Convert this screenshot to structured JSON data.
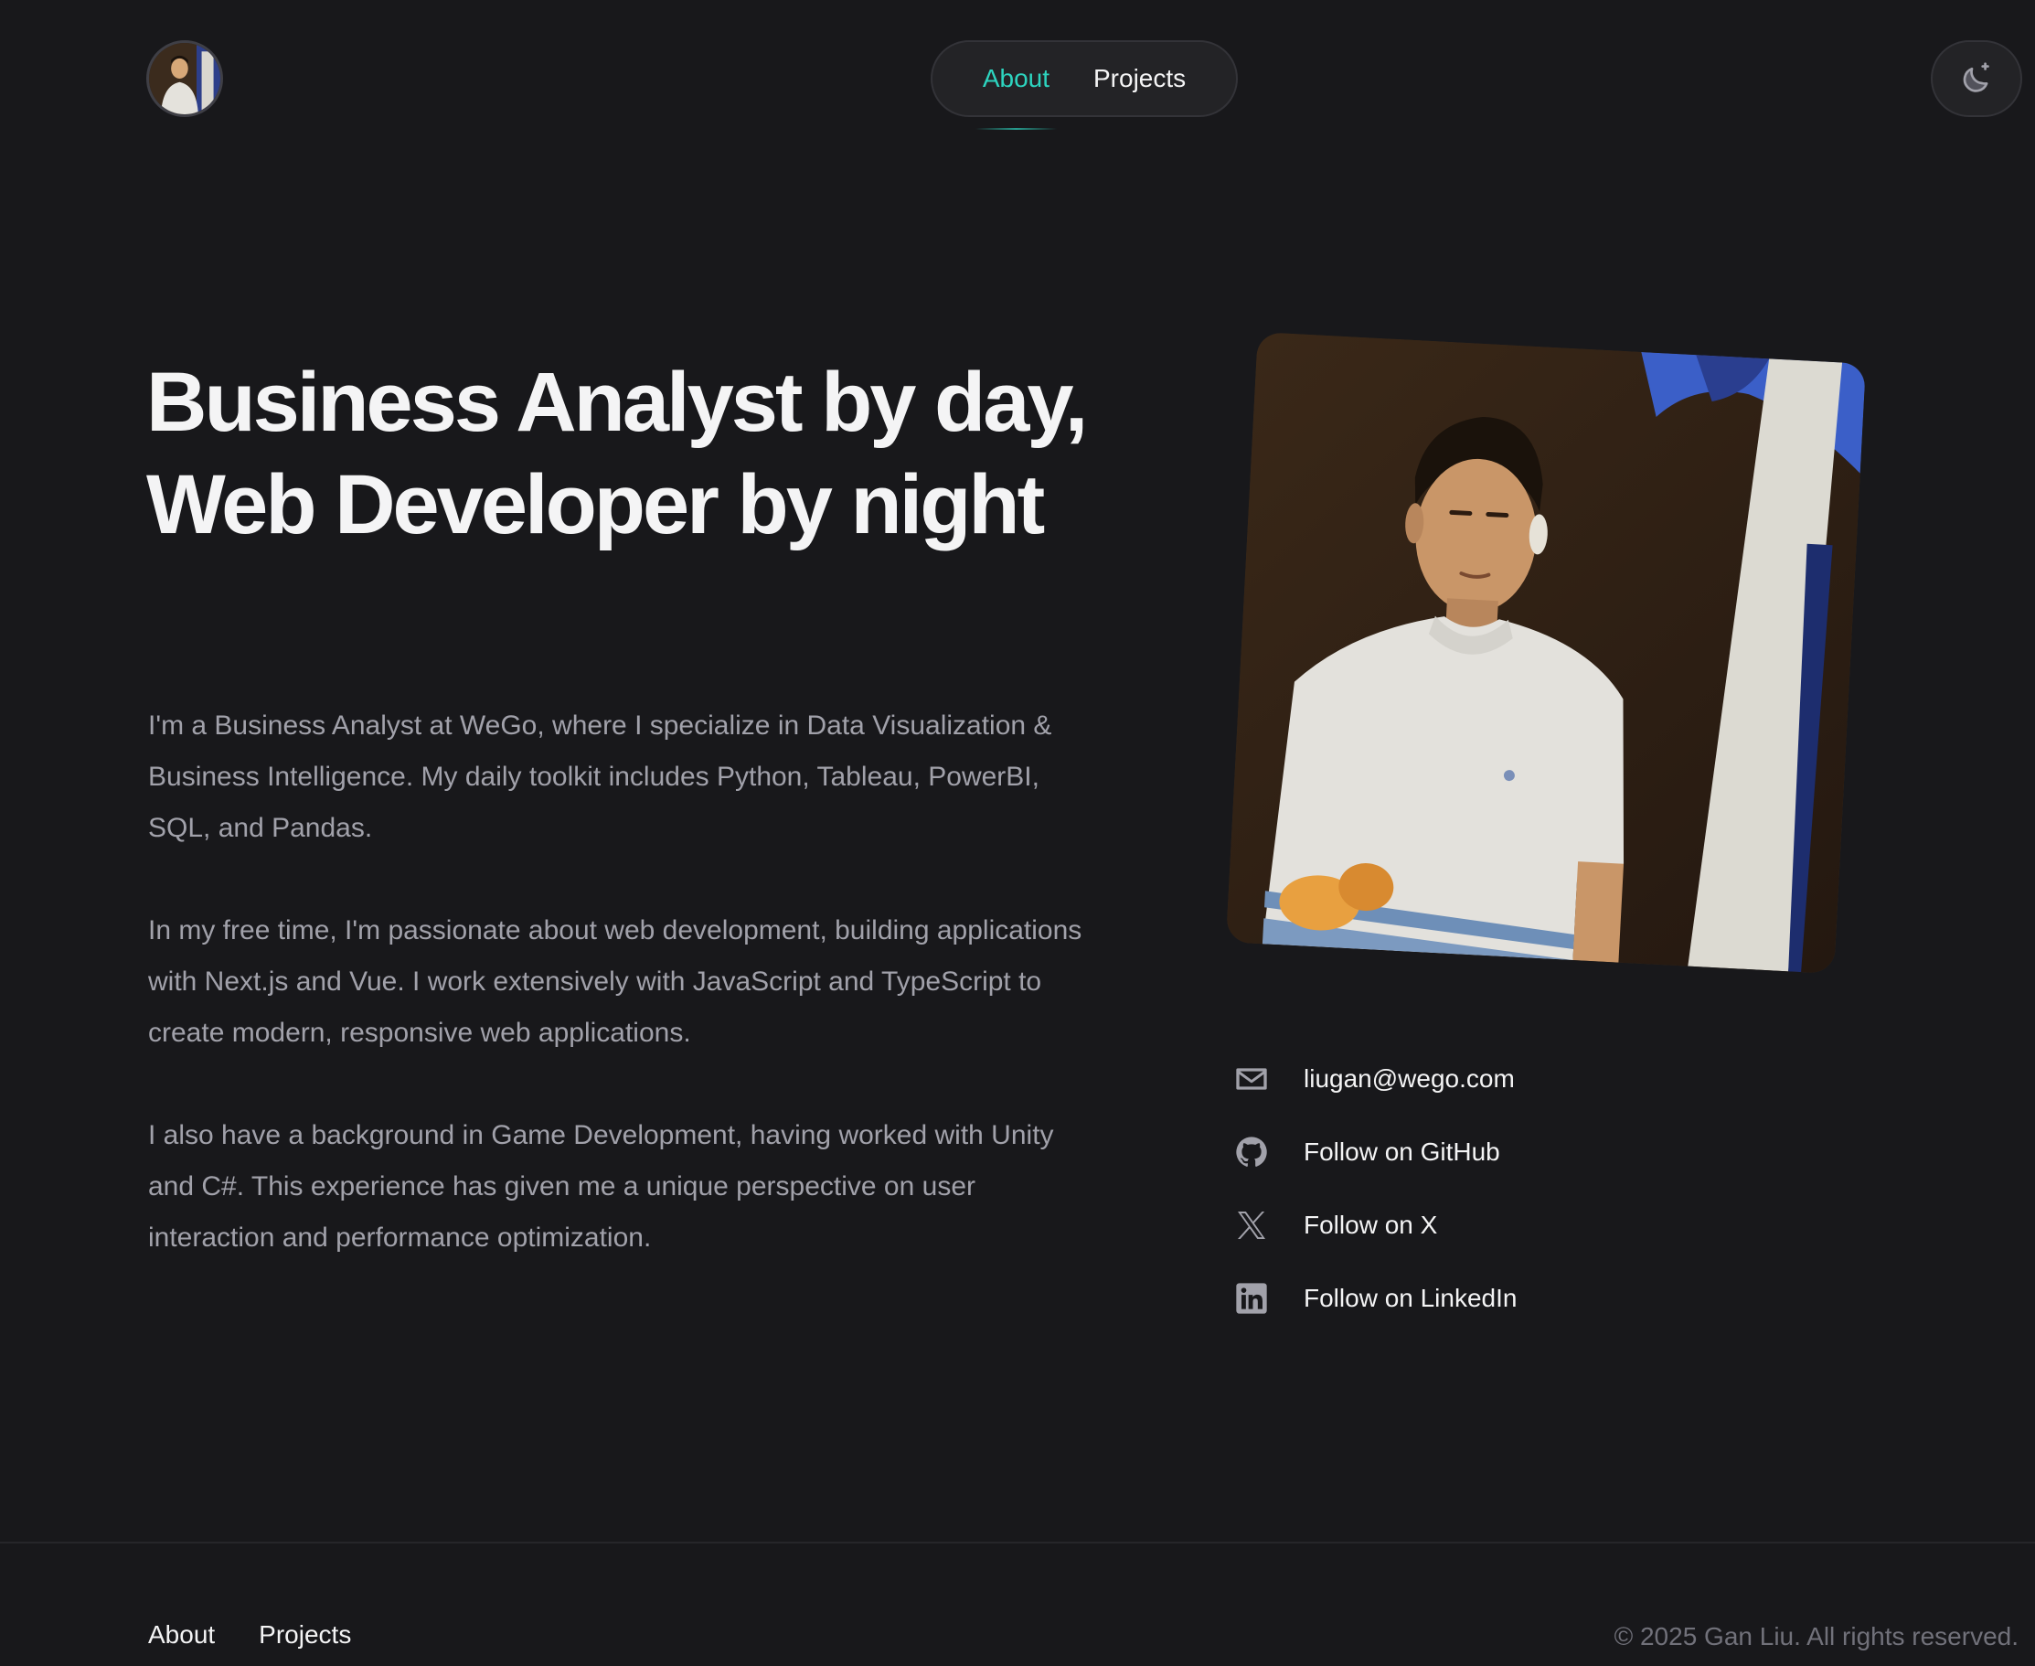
{
  "header": {
    "nav": [
      {
        "label": "About",
        "active": true
      },
      {
        "label": "Projects",
        "active": false
      }
    ],
    "theme_icon": "moon-sparkle-icon"
  },
  "hero": {
    "headline": "Business Analyst by day, Web Developer by night",
    "paragraphs": [
      "I'm a Business Analyst at WeGo, where I specialize in Data Visualization & Business Intelligence. My daily toolkit includes Python, Tableau, PowerBI, SQL, and Pandas.",
      "In my free time, I'm passionate about web development, building applications with Next.js and Vue. I work extensively with JavaScript and TypeScript to create modern, responsive web applications.",
      "I also have a background in Game Development, having worked with Unity and C#. This experience has given me a unique perspective on user interaction and performance optimization."
    ]
  },
  "social": [
    {
      "icon": "mail-icon",
      "label": "liugan@wego.com"
    },
    {
      "icon": "github-icon",
      "label": "Follow on GitHub"
    },
    {
      "icon": "x-icon",
      "label": "Follow on X"
    },
    {
      "icon": "linkedin-icon",
      "label": "Follow on LinkedIn"
    }
  ],
  "footer": {
    "nav": [
      "About",
      "Projects"
    ],
    "copyright": "© 2025 Gan Liu. All rights reserved."
  },
  "colors": {
    "background": "#18181b",
    "accent": "#2dd4bf",
    "text": "#f4f4f5",
    "muted": "#a1a1aa"
  }
}
